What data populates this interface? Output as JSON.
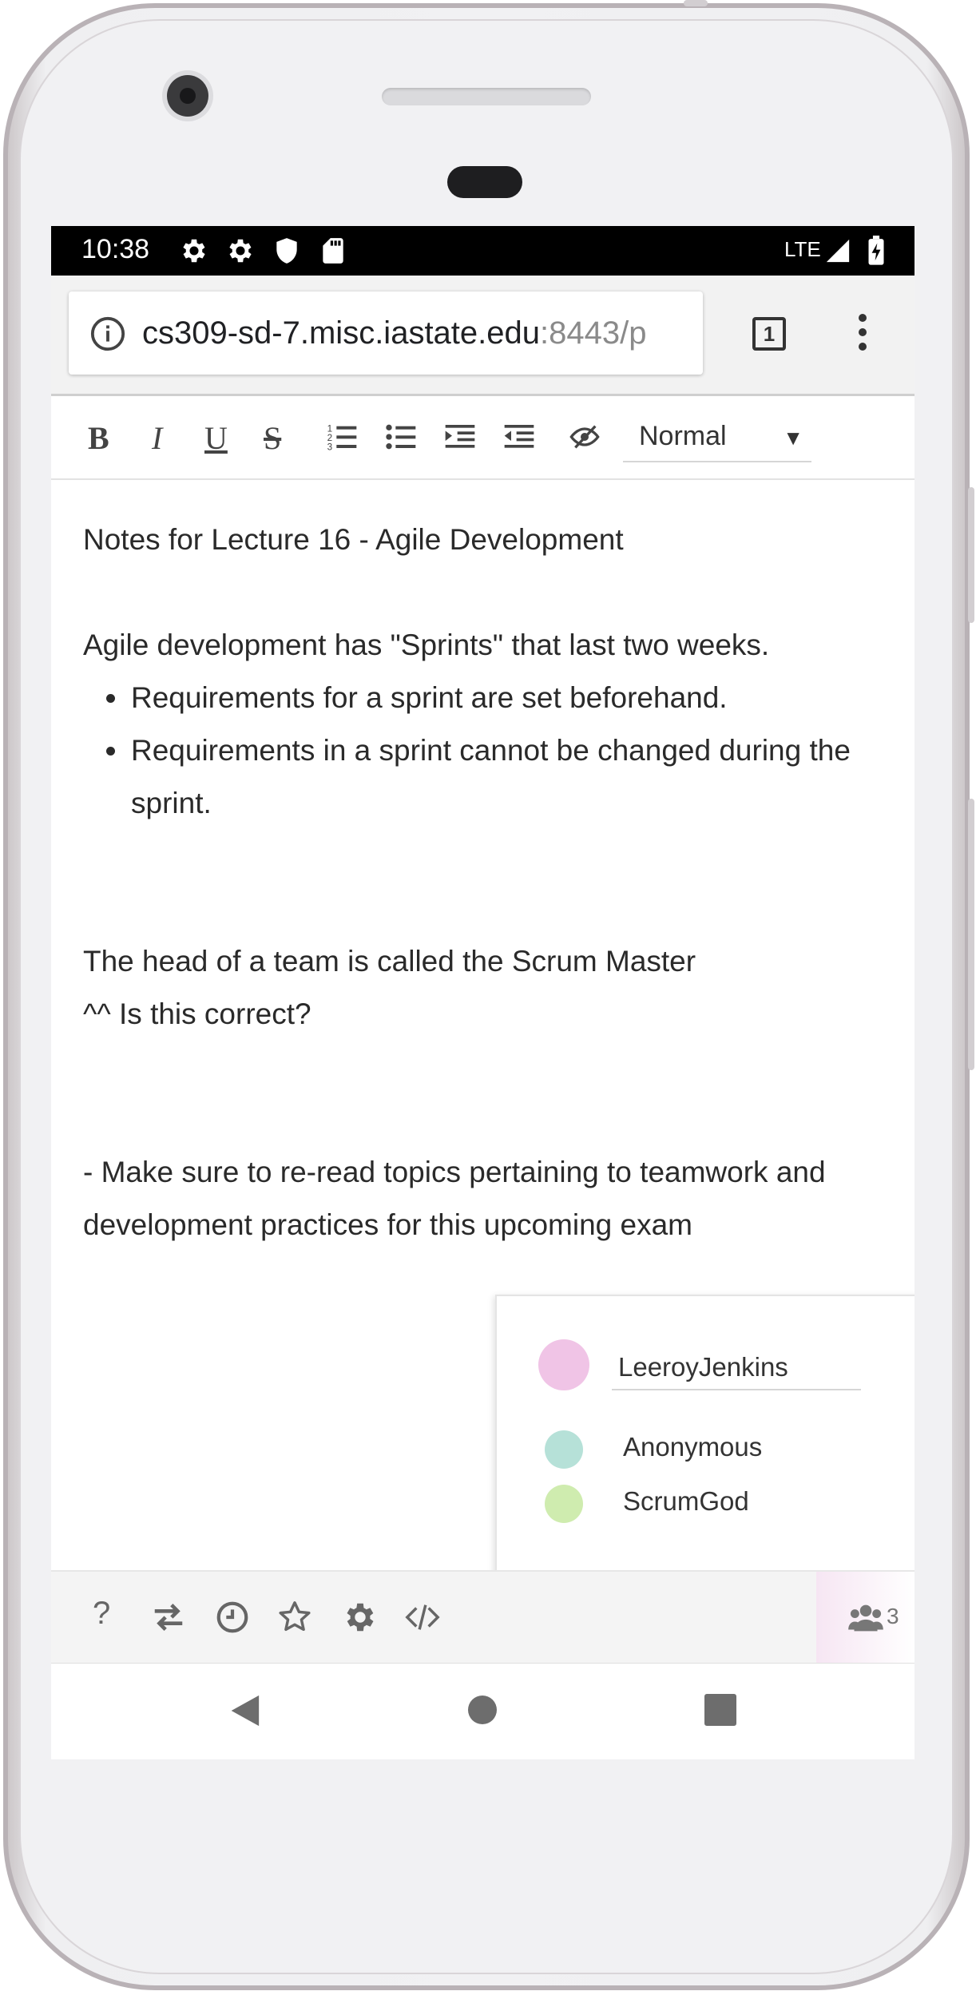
{
  "status_bar": {
    "time": "10:38",
    "network": "LTE"
  },
  "browser": {
    "url_host": "cs309-sd-7.misc.iastate.edu",
    "url_rest": ":8443/p",
    "tab_count": "1"
  },
  "toolbar": {
    "bold": "B",
    "italic": "I",
    "underline": "U",
    "strike": "S",
    "format_value": "Normal",
    "format_arrow": "▼"
  },
  "document": {
    "title": "Notes for Lecture 16 - Agile Development",
    "para1": "Agile development has \"Sprints\" that last two weeks.",
    "bullets": [
      "Requirements for a sprint are set beforehand.",
      "Requirements in a sprint cannot be changed during the sprint."
    ],
    "para2": "The head of a team is called the Scrum Master",
    "para3": "^^ Is this correct?",
    "para4": "- Make sure to re-read topics pertaining to teamwork and development practices for this upcoming exam"
  },
  "users": {
    "self_name": "LeeroyJenkins",
    "self_color": "#f0c4e6",
    "others": [
      {
        "name": "Anonymous",
        "color": "#b6e1d8"
      },
      {
        "name": "ScrumGod",
        "color": "#cfecaf"
      }
    ],
    "count": "3"
  },
  "bottom_bar": {
    "help": "?"
  }
}
